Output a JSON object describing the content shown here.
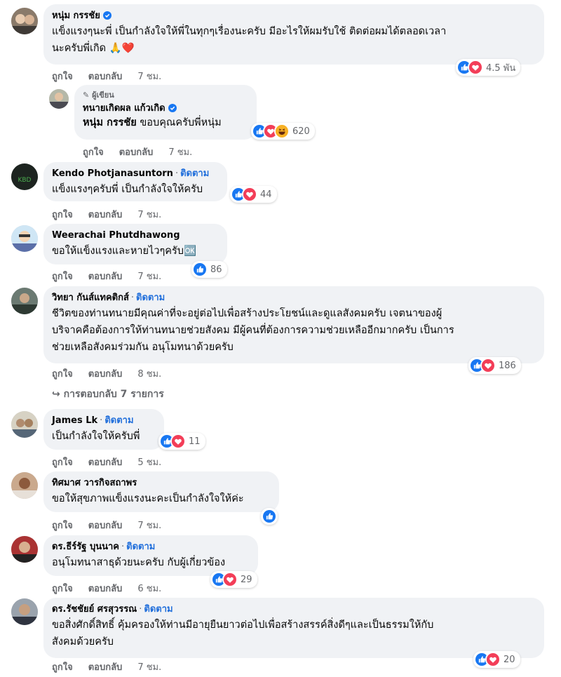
{
  "actions": {
    "like": "ถูกใจ",
    "reply": "ตอบกลับ"
  },
  "follow_label": "ติดตาม",
  "author_badge": "ผู้เขียน",
  "colors": {
    "like_blue": "#1877f2",
    "love_red": "#f33e58",
    "haha_yellow": "#f7b125",
    "link_blue": "#216fdb"
  },
  "comments": [
    {
      "name": "หนุ่ม กรรชัย",
      "verified": true,
      "lines": [
        "แข็งแรงๆนะพี่ เป็นกำลังใจให้พี่ในทุกๆเรื่องนะครับ มีอะไรให้ผมรับใช้ ติดต่อผมได้ตลอดเวลา",
        "นะครับพี่เกิด 🙏❤️"
      ],
      "time": "7 ชม.",
      "reaction_count": "4.5 พัน",
      "reactions": [
        "like-icon",
        "love-icon"
      ]
    },
    {
      "name": "ทนายเกิดผล แก้วเกิด",
      "verified": true,
      "is_author": true,
      "tag": "หนุ่ม กรรชัย",
      "text": " ขอบคุณครับพี่หนุ่ม",
      "time": "7 ชม.",
      "reaction_count": "620",
      "reactions": [
        "like-icon",
        "love-icon",
        "haha-icon"
      ]
    },
    {
      "name": "Kendo Photjanasuntorn",
      "follow": true,
      "lines": [
        "แข็งแรงๆครับพี่ เป็นกำลังใจให้ครับ"
      ],
      "time": "7 ชม.",
      "reaction_count": "44",
      "reactions": [
        "like-icon",
        "love-icon"
      ]
    },
    {
      "name": "Weerachai Phutdhawong",
      "lines": [
        "ขอให้แข็งแรงและหายไวๆครับ🆗"
      ],
      "time": "7 ชม.",
      "reaction_count": "86",
      "reactions": [
        "like-icon"
      ]
    },
    {
      "name": "วิทยา กันส์แทคติกส์",
      "follow": true,
      "lines": [
        "ชีวิตของท่านทนายมีคุณค่าที่จะอยู่ต่อไปเพื่อสร้างประโยชน์และดูแลสังคมครับ เจตนาของผู้",
        "บริจาคคือต้องการให้ท่านทนายช่วยสังคม มีผู้คนที่ต้องการความช่วยเหลืออีกมากครับ เป็นการ",
        "ช่วยเหลือสังคมร่วมกัน อนุโมทนาด้วยครับ"
      ],
      "time": "8 ชม.",
      "reaction_count": "186",
      "reactions": [
        "like-icon",
        "love-icon"
      ],
      "replies_label": "การตอบกลับ 7 รายการ"
    },
    {
      "name": "James Lk",
      "follow": true,
      "lines": [
        "เป็นกำลังใจให้ครับพี่"
      ],
      "time": "5 ชม.",
      "reaction_count": "11",
      "reactions": [
        "like-icon",
        "love-icon"
      ]
    },
    {
      "name": "ทิศมาศ วารกิจสถาพร",
      "lines": [
        "ขอให้สุขภาพแข็งแรงนะคะเป็นกำลังใจให้ค่ะ"
      ],
      "time": "7 ชม.",
      "reaction_count": "",
      "reactions": [
        "like-icon"
      ]
    },
    {
      "name": "ดร.ธีร์รัฐ บุนนาค",
      "follow": true,
      "lines": [
        "อนุโมทนาสาธุด้วยนะครับ กับผู้เกี่ยวข้อง"
      ],
      "time": "6 ชม.",
      "reaction_count": "29",
      "reactions": [
        "like-icon",
        "love-icon"
      ]
    },
    {
      "name": "ดร.รัชชัยย์ ศรสุวรรณ",
      "follow": true,
      "lines": [
        "ขอสิ่งศักดิ์สิทธิ์ คุ้มครองให้ท่านมีอายุยืนยาวต่อไปเพื่อสร้างสรรค์สิ่งดีๆและเป็นธรรมให้กับ",
        "สังคมด้วยครับ"
      ],
      "time": "7 ชม.",
      "reaction_count": "20",
      "reactions": [
        "like-icon",
        "love-icon"
      ]
    }
  ]
}
